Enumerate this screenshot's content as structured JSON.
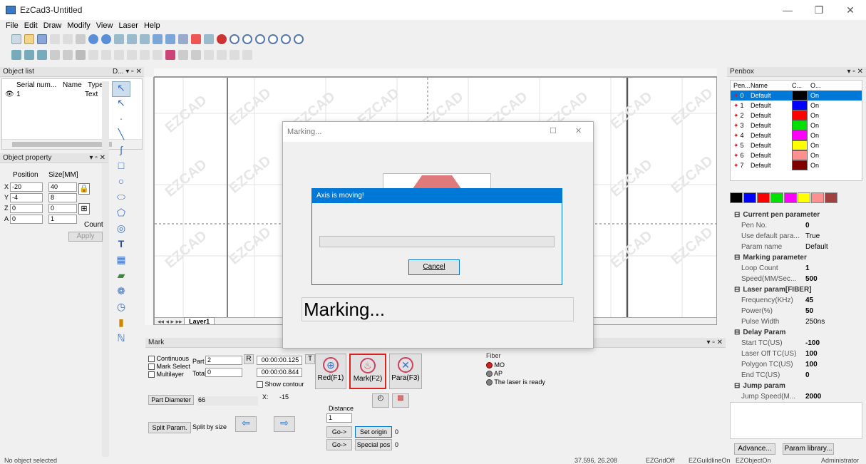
{
  "window": {
    "title": "EzCad3-Untitled",
    "min": "—",
    "max": "❐",
    "close": "✕"
  },
  "menu": [
    "File",
    "Edit",
    "Draw",
    "Modify",
    "View",
    "Laser",
    "Help"
  ],
  "object_list": {
    "header": "Object list",
    "columns": [
      "Serial num...",
      "Name",
      "Type"
    ],
    "rows": [
      {
        "serial": "1",
        "name": "",
        "type": "Text"
      }
    ]
  },
  "draw_panel": {
    "header": "D..."
  },
  "object_property": {
    "header": "Object property",
    "position_label": "Position",
    "size_label": "Size[MM]",
    "rows": [
      {
        "axis": "X",
        "pos": "-20",
        "size": "40"
      },
      {
        "axis": "Y",
        "pos": "-4",
        "size": "8"
      },
      {
        "axis": "Z",
        "pos": "0",
        "size": "0"
      },
      {
        "axis": "A",
        "pos": "0",
        "size": "1"
      }
    ],
    "count_label": "Count",
    "apply_label": "Apply"
  },
  "canvas": {
    "layer_tab": "Layer1",
    "watermark": "EZCAD"
  },
  "marking_dialog": {
    "title": "Marking...",
    "status_text": "Marking..."
  },
  "alert": {
    "title": "Axis is moving!",
    "progress": 0,
    "cancel_label": "Cancel"
  },
  "mark_panel": {
    "header": "Mark",
    "continuous": "Continuous",
    "mark_select": "Mark Select",
    "multilayer": "Multilayer",
    "part_label": "Part",
    "part_value": "2",
    "total_label": "Total",
    "total_value": "0",
    "r_label": "R",
    "t_label": "T",
    "time1": "00:00:00.125",
    "time2": "00:00:00.844",
    "show_contour": "Show contour",
    "red_label": "Red(F1)",
    "mark_label": "Mark(F2)",
    "para_label": "Para(F3)",
    "part_diameter_label": "Part Diameter",
    "part_diameter_value": "66",
    "x_label": "X:",
    "x_value": "-15",
    "distance_label": "Distance",
    "distance_value": "1",
    "split_param": "Split Param.",
    "split_by_size": "Split by size",
    "go1": "Go->",
    "go2": "Go->",
    "set_origin": "Set origin",
    "set_origin_value": "0",
    "special_pos": "Special pos",
    "special_pos_value": "0"
  },
  "fiber": {
    "header": "Fiber",
    "items": [
      {
        "label": "MO",
        "color": "#d02020"
      },
      {
        "label": "AP",
        "color": "#808080"
      },
      {
        "label": "The laser is ready",
        "color": "#808080"
      }
    ]
  },
  "penbox": {
    "header": "Penbox",
    "columns": [
      "Pen...",
      "Name",
      "C...",
      "O..."
    ],
    "pens": [
      {
        "no": "0",
        "name": "Default",
        "color": "#000000",
        "on": "On"
      },
      {
        "no": "1",
        "name": "Default",
        "color": "#0000ff",
        "on": "On"
      },
      {
        "no": "2",
        "name": "Default",
        "color": "#ff0000",
        "on": "On"
      },
      {
        "no": "3",
        "name": "Default",
        "color": "#00e000",
        "on": "On"
      },
      {
        "no": "4",
        "name": "Default",
        "color": "#ff00ff",
        "on": "On"
      },
      {
        "no": "5",
        "name": "Default",
        "color": "#ffff00",
        "on": "On"
      },
      {
        "no": "6",
        "name": "Default",
        "color": "#ff9090",
        "on": "On"
      },
      {
        "no": "7",
        "name": "Default",
        "color": "#800000",
        "on": "On"
      }
    ],
    "swatches": [
      "#000000",
      "#0000ff",
      "#ff0000",
      "#00e000",
      "#ff00ff",
      "#ffff00",
      "#ff9090",
      "#a04040"
    ]
  },
  "pen_params": {
    "categories": [
      {
        "name": "Current pen parameter",
        "rows": [
          {
            "k": "Pen No.",
            "v": "0"
          },
          {
            "k": "Use default para...",
            "v": "True"
          },
          {
            "k": "Param name",
            "v": "Default"
          }
        ]
      },
      {
        "name": "Marking parameter",
        "rows": [
          {
            "k": "Loop Count",
            "v": "1"
          },
          {
            "k": "Speed(MM/Sec...",
            "v": "500"
          }
        ]
      },
      {
        "name": "Laser param[FIBER]",
        "rows": [
          {
            "k": "Frequency(KHz)",
            "v": "45"
          },
          {
            "k": "Power(%)",
            "v": "50"
          },
          {
            "k": "Pulse Width",
            "v": "250ns"
          }
        ]
      },
      {
        "name": "Delay Param",
        "rows": [
          {
            "k": "Start TC(US)",
            "v": "-100"
          },
          {
            "k": "Laser Off TC(US)",
            "v": "100"
          },
          {
            "k": "Polygon TC(US)",
            "v": "100"
          },
          {
            "k": "End TC(US)",
            "v": "0"
          }
        ]
      },
      {
        "name": "Jump param",
        "rows": [
          {
            "k": "Jump Speed(M...",
            "v": "2000"
          }
        ]
      }
    ],
    "advance_label": "Advance...",
    "param_library_label": "Param library..."
  },
  "status": {
    "left": "No object selected",
    "coords": "37.596, 26.208",
    "grid": "EZGridOff",
    "guideline": "EZGuildlineOn",
    "object": "EZObjectOn",
    "user": "Administrator"
  }
}
